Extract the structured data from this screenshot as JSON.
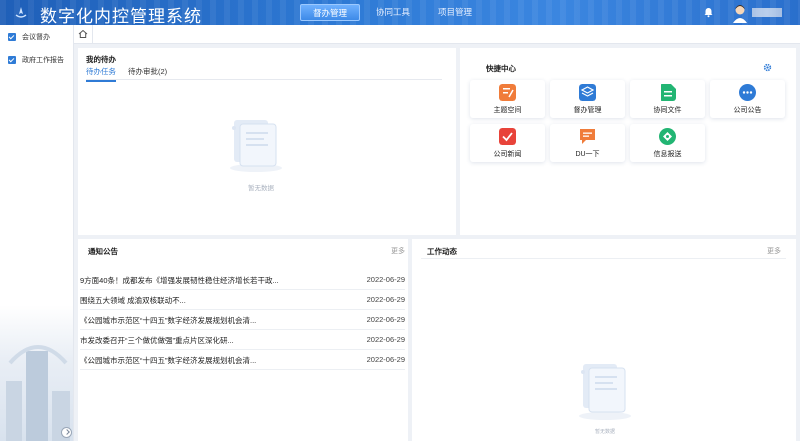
{
  "header": {
    "title": "数字化内控管理系统",
    "nav": [
      {
        "label": "督办管理",
        "active": true
      },
      {
        "label": "协同工具",
        "active": false
      },
      {
        "label": "项目管理",
        "active": false
      }
    ]
  },
  "sidebar": {
    "items": [
      {
        "label": "会议督办"
      },
      {
        "label": "政府工作报告"
      }
    ]
  },
  "todo": {
    "title": "我的待办",
    "tabs": [
      {
        "label": "待办任务",
        "active": true
      },
      {
        "label": "待办审批(2)",
        "active": false
      }
    ],
    "empty_text": "暂无数据"
  },
  "quick": {
    "title": "快捷中心",
    "items": [
      {
        "label": "主题空间",
        "icon": "edit-icon",
        "color": "#f07c3a"
      },
      {
        "label": "督办管理",
        "icon": "layers-icon",
        "color": "#2f7bd6"
      },
      {
        "label": "协同文件",
        "icon": "file-icon",
        "color": "#22b573"
      },
      {
        "label": "公司公告",
        "icon": "chat-icon",
        "color": "#2f7bd6"
      },
      {
        "label": "公司新闻",
        "icon": "check-icon",
        "color": "#e8433a"
      },
      {
        "label": "DU一下",
        "icon": "message-icon",
        "color": "#f07c3a"
      },
      {
        "label": "信息报送",
        "icon": "diamond-icon",
        "color": "#22b573"
      }
    ]
  },
  "notice": {
    "title": "通知公告",
    "more": "更多",
    "rows": [
      {
        "title": "9方面40条！成都发布《增强发展韧性稳住经济增长若干政...",
        "date": "2022-06-29"
      },
      {
        "title": "围绕五大领域 成渝双核联动不...",
        "date": "2022-06-29"
      },
      {
        "title": "《公园城市示范区“十四五”数字经济发展规划机会清...",
        "date": "2022-06-29"
      },
      {
        "title": "市发改委召开“三个做优做强”重点片区深化研...",
        "date": "2022-06-29"
      },
      {
        "title": "《公园城市示范区“十四五”数字经济发展规划机会清...",
        "date": "2022-06-29"
      }
    ]
  },
  "work": {
    "title": "工作动态",
    "more": "更多",
    "empty_text": "暂无数据"
  },
  "colors": {
    "accent": "#2f7bd6",
    "header": "#2f7bd6"
  }
}
